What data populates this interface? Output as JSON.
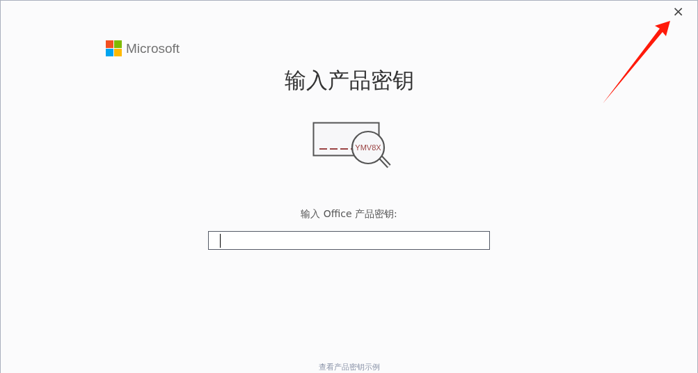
{
  "close_button": {
    "label": "×"
  },
  "brand": {
    "name": "Microsoft"
  },
  "title": "输入产品密钥",
  "illustration": {
    "key_sample": "YMV8X"
  },
  "key_field": {
    "label": "输入 Office 产品密钥:"
  },
  "link": "查看产品密钥示例"
}
